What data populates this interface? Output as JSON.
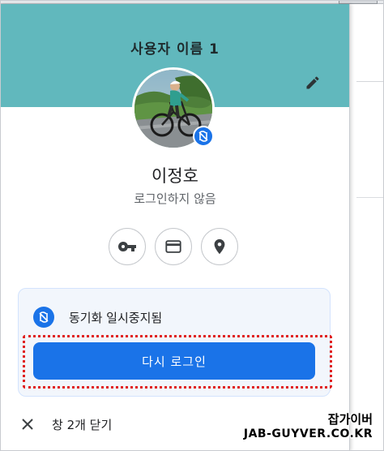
{
  "header": {
    "profile_name": "사용자 이름 1",
    "background_color": "#61b8bd",
    "edit_icon": "pencil-icon"
  },
  "user": {
    "name": "이정호",
    "status": "로그인하지 않음",
    "avatar": "cyclist-photo",
    "badge_icon": "sync-paused-icon"
  },
  "actions": [
    {
      "name": "passwords",
      "icon": "key-icon"
    },
    {
      "name": "payment-methods",
      "icon": "credit-card-icon"
    },
    {
      "name": "addresses",
      "icon": "location-pin-icon"
    }
  ],
  "sync": {
    "status_text": "동기화 일시중지됨",
    "icon": "sync-paused-icon",
    "button_label": "다시 로그인",
    "accent_color": "#1a73e8",
    "highlight_color": "#e0201f"
  },
  "footer": {
    "close_label": "창 2개 닫기",
    "close_icon": "close-icon"
  },
  "watermark": {
    "line1": "잡가이버",
    "line2": "JAB-GUYVER.CO.KR"
  }
}
